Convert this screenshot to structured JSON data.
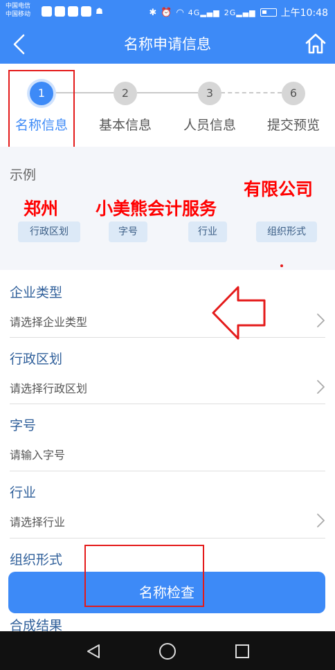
{
  "status_bar": {
    "carrier1": "中国电信",
    "carrier2": "中国移动",
    "network1": "4G",
    "network2": "2G",
    "time": "上午10:48"
  },
  "header": {
    "title": "名称申请信息",
    "back_icon": "chevron-left-icon",
    "home_icon": "home-icon"
  },
  "steps": [
    {
      "number": "1",
      "label": "名称信息",
      "active": true
    },
    {
      "number": "2",
      "label": "基本信息",
      "active": false
    },
    {
      "number": "3",
      "label": "人员信息",
      "active": false
    },
    {
      "number": "6",
      "label": "提交预览",
      "active": false
    }
  ],
  "example": {
    "title": "示例",
    "annotation": {
      "region": "郑州",
      "name": "小美熊会计服务",
      "org": "有限公司"
    },
    "chips": [
      "行政区划",
      "字号",
      "行业",
      "组织形式"
    ]
  },
  "form": {
    "fields": [
      {
        "label": "企业类型",
        "placeholder": "请选择企业类型",
        "has_chevron": true
      },
      {
        "label": "行政区划",
        "placeholder": "请选择行政区划",
        "has_chevron": true
      },
      {
        "label": "字号",
        "placeholder": "请输入字号",
        "has_chevron": false
      },
      {
        "label": "行业",
        "placeholder": "请选择行业",
        "has_chevron": true
      }
    ],
    "org_form_label": "组织形式",
    "check_button": "名称检查",
    "result_label": "合成结果"
  },
  "colors": {
    "accent": "#3d8af7",
    "annotation_red": "#e41a1a",
    "label_blue": "#2f5f9a"
  }
}
